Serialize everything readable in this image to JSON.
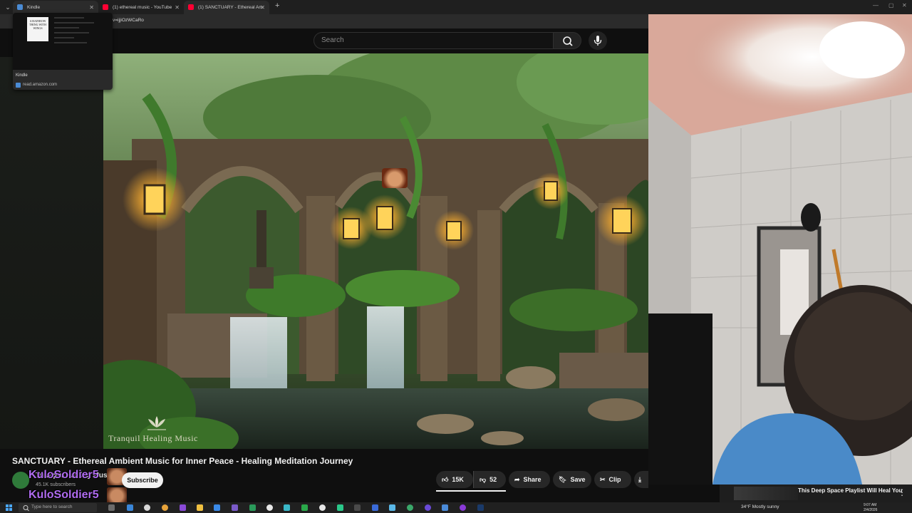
{
  "browser": {
    "tabs": [
      {
        "title": "Kindle",
        "active": true,
        "favicon_color": "#4a8bd4"
      },
      {
        "title": "(1) ethereal music - YouTube",
        "active": false,
        "favicon_color": "#ff0033"
      },
      {
        "title": "(1) SANCTUARY - Ethereal Am",
        "active": false,
        "favicon_color": "#ff0033"
      }
    ],
    "address_partial": "v=ijjiOzWCaRo",
    "tab_preview": {
      "title": "Kindle",
      "site": "read.amazon.com",
      "book_cover_text": "A RAINBOW THING WITH WINGS"
    }
  },
  "youtube": {
    "search_placeholder": "Search",
    "video": {
      "title": "SANCTUARY - Ethereal Ambient Music for Inner Peace - Healing Meditation Journey",
      "watermark": "Tranquil Healing Music"
    },
    "channel": {
      "name": "Tranquil Healing Music",
      "subscribers": "45.1K subscribers",
      "subscribe_label": "Subscribe"
    },
    "actions": {
      "likes": "15K",
      "dislikes": "52",
      "share": "Share",
      "save": "Save",
      "clip": "Clip"
    },
    "like_ratio": 0.997
  },
  "stream_overlay": {
    "username": "KuloSoldier5",
    "username_color": "#b06cf0"
  },
  "notification": {
    "text": "This Deep Space Playlist Will Heal You"
  },
  "taskbar": {
    "search_placeholder": "Type here to search",
    "weather": "34°F  Mostly sunny",
    "time": "9:07 AM",
    "date": "2/4/2026"
  },
  "colors": {
    "youtube_bg": "#0f0f0f",
    "youtube_red": "#ff0033",
    "pill_bg": "#272727"
  }
}
